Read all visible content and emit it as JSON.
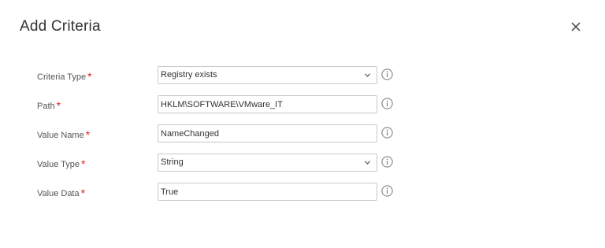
{
  "dialog": {
    "title": "Add Criteria",
    "close_icon": "close-icon"
  },
  "form": {
    "fields": [
      {
        "label": "Criteria Type",
        "required": "*",
        "kind": "select",
        "value": "Registry exists",
        "icon": "info-icon"
      },
      {
        "label": "Path",
        "required": "*",
        "kind": "text",
        "value": "HKLM\\SOFTWARE\\VMware_IT",
        "icon": "info-icon"
      },
      {
        "label": "Value Name",
        "required": "*",
        "kind": "text",
        "value": "NameChanged",
        "icon": "info-icon"
      },
      {
        "label": "Value Type",
        "required": "*",
        "kind": "select",
        "value": "String",
        "icon": "info-icon"
      },
      {
        "label": "Value Data",
        "required": "*",
        "kind": "text",
        "value": "True",
        "icon": "info-icon"
      }
    ]
  },
  "colors": {
    "required_star": "#e02020",
    "border": "#c8c8c8",
    "label": "#555555"
  }
}
